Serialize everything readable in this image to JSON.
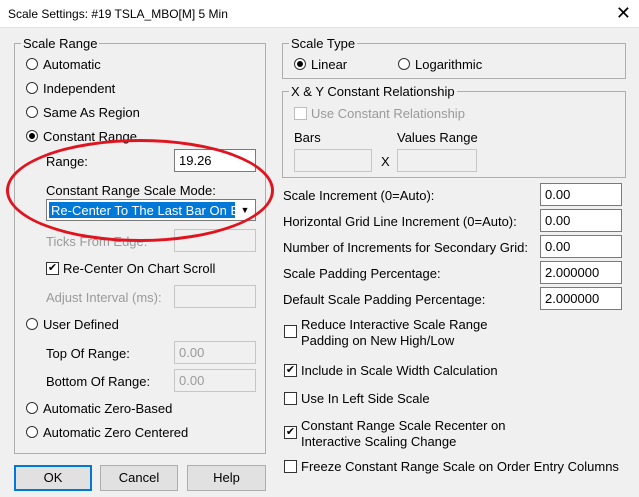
{
  "window": {
    "title": "Scale Settings: #19 TSLA_MBO[M]  5 Min",
    "close_glyph": "✕"
  },
  "scale_range": {
    "legend": "Scale Range",
    "automatic": "Automatic",
    "independent": "Independent",
    "same_as_region": "Same As Region",
    "constant_range": "Constant Range",
    "range_label": "Range:",
    "range_value": "19.26",
    "mode_label": "Constant Range Scale Mode:",
    "mode_value": "Re-Center To The Last Bar On Edge",
    "ticks_label": "Ticks From Edge:",
    "recenter_label": "Re-Center On Chart Scroll",
    "adjust_label": "Adjust Interval (ms):",
    "user_defined": "User Defined",
    "top_label": "Top Of Range:",
    "top_value": "0.00",
    "bottom_label": "Bottom Of Range:",
    "bottom_value": "0.00",
    "auto_zero_based": "Automatic Zero-Based",
    "auto_zero_centered": "Automatic Zero Centered",
    "selected": "constant_range"
  },
  "scale_type": {
    "legend": "Scale Type",
    "linear": "Linear",
    "logarithmic": "Logarithmic",
    "selected": "linear"
  },
  "xy": {
    "legend": "X & Y Constant Relationship",
    "use_label": "Use Constant Relationship",
    "bars_label": "Bars",
    "values_label": "Values Range",
    "x_label": "X"
  },
  "settings": {
    "scale_increment_label": "Scale Increment (0=Auto):",
    "scale_increment_value": "0.00",
    "hgrid_label": "Horizontal Grid Line Increment (0=Auto):",
    "hgrid_value": "0.00",
    "secondary_label": "Number of Increments for Secondary Grid:",
    "secondary_value": "0.00",
    "padding_label": "Scale Padding Percentage:",
    "padding_value": "2.000000",
    "default_padding_label": "Default Scale Padding Percentage:",
    "default_padding_value": "2.000000"
  },
  "checks": {
    "reduce_line1": "Reduce Interactive Scale Range",
    "reduce_line2": "Padding on New High/Low",
    "include_width": "Include in Scale Width Calculation",
    "left_side": "Use In Left Side Scale",
    "recenter_line1": "Constant Range Scale Recenter on",
    "recenter_line2": "Interactive Scaling Change",
    "freeze": "Freeze Constant Range Scale on Order Entry Columns"
  },
  "buttons": {
    "ok": "OK",
    "cancel": "Cancel",
    "help": "Help"
  },
  "colors": {
    "accent": "#0078d7",
    "annotation_ring": "#e0141e"
  }
}
